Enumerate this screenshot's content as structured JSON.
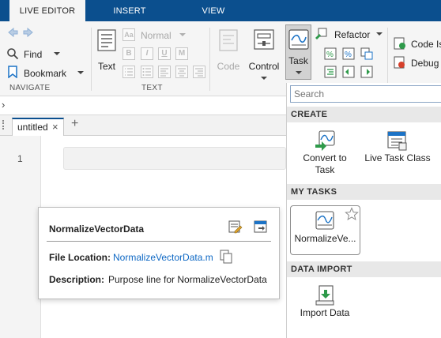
{
  "tabs": [
    {
      "label": "LIVE EDITOR",
      "active": true
    },
    {
      "label": "INSERT",
      "active": false
    },
    {
      "label": "VIEW",
      "active": false
    }
  ],
  "navigate": {
    "find_label": "Find",
    "bookmark_label": "Bookmark",
    "group_label": "NAVIGATE"
  },
  "text_group": {
    "text_button_label": "Text",
    "style_select_value": "Normal",
    "format_buttons": [
      "B",
      "I",
      "U",
      "M"
    ],
    "group_label": "TEXT"
  },
  "code_group": {
    "code_label": "Code",
    "control_label": "Control",
    "task_label": "Task"
  },
  "refactor": {
    "refactor_label": "Refactor",
    "code_issues_label": "Code Is",
    "debug_label": "Debug"
  },
  "editor": {
    "document_tab": "untitled",
    "close_symbol": "×",
    "add_tab_symbol": "+",
    "line_number": "1",
    "path_caret": "›"
  },
  "gallery": {
    "search_placeholder": "Search",
    "create_header": "CREATE",
    "create_items": [
      {
        "label_line1": "Convert to",
        "label_line2": "Task"
      },
      {
        "label_line1": "Live Task Class",
        "label_line2": ""
      }
    ],
    "my_tasks_header": "MY TASKS",
    "my_tasks_item": "NormalizeVe...",
    "data_import_header": "DATA IMPORT",
    "data_import_item": "Import Data"
  },
  "details": {
    "title": "NormalizeVectorData",
    "file_location_key": "File Location:",
    "file_location_value": "NormalizeVectorData.m",
    "description_key": "Description:",
    "description_value": "Purpose line for NormalizeVectorData"
  },
  "colors": {
    "tab_bar": "#0b4f8e",
    "link": "#0e68c4",
    "accent_green": "#2e9a4a",
    "icon_blue": "#1c73c6"
  }
}
